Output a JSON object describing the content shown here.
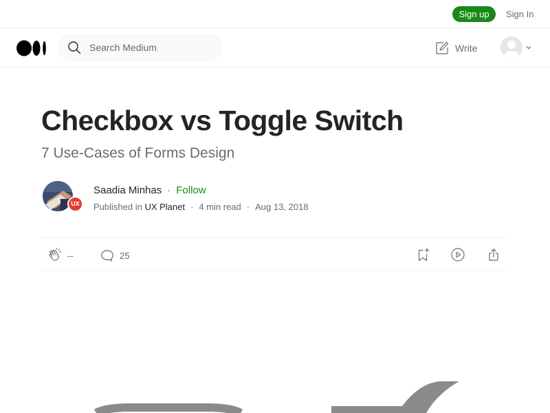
{
  "topbar": {
    "signup_label": "Sign up",
    "signin_label": "Sign In"
  },
  "header": {
    "logo_icon": "medium-logo-icon",
    "search": {
      "placeholder": "Search Medium",
      "value": ""
    },
    "write_label": "Write"
  },
  "article": {
    "title": "Checkbox vs Toggle Switch",
    "subtitle": "7 Use-Cases of Forms Design",
    "author": {
      "name": "Saadia Minhas",
      "follow_label": "Follow",
      "separator": "·"
    },
    "publication": {
      "prefix": "Published in",
      "name": "UX Planet",
      "badge": "UX",
      "read_time": "4 min read",
      "date": "Aug 13, 2018",
      "separator": "·"
    },
    "actions": {
      "claps": "--",
      "comments": "25"
    }
  },
  "colors": {
    "accent_green": "#1a8917",
    "text_primary": "#242424",
    "text_secondary": "#6b6b6b",
    "badge_red": "#e53935"
  }
}
